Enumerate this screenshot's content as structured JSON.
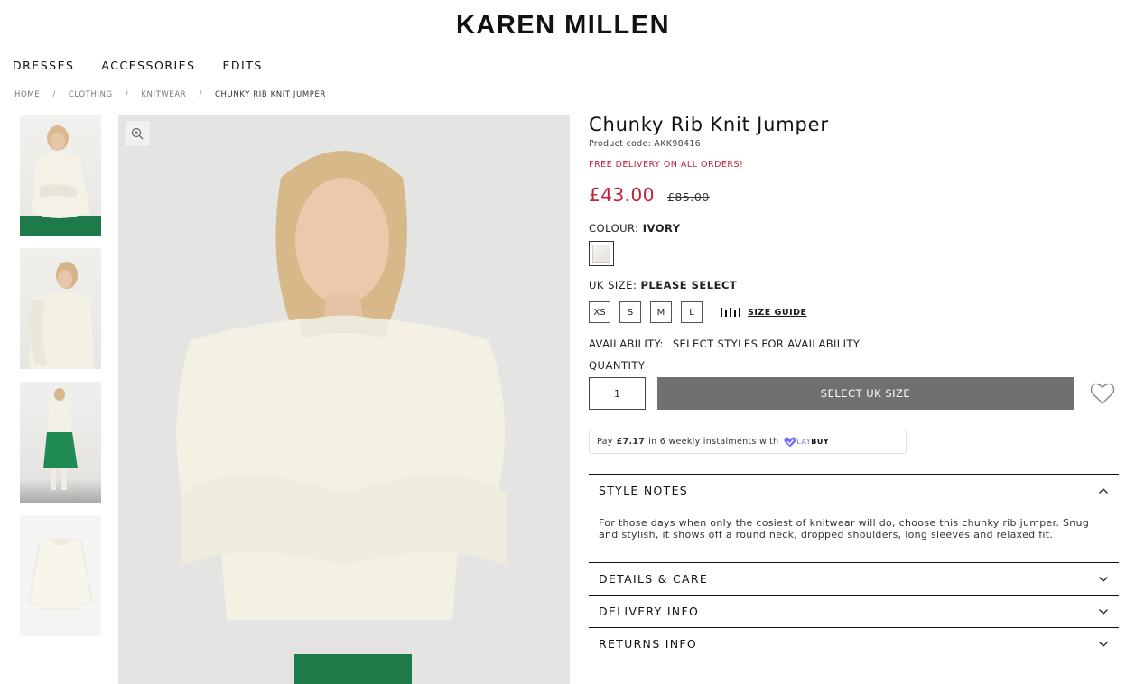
{
  "brand": {
    "logo_text": "KAREN MILLEN"
  },
  "nav": {
    "items": [
      "DRESSES",
      "ACCESSORIES",
      "EDITS"
    ]
  },
  "breadcrumb": {
    "items": [
      "HOME",
      "CLOTHING",
      "KNITWEAR",
      "CHUNKY RIB KNIT JUMPER"
    ],
    "separator": "/"
  },
  "product": {
    "title": "Chunky Rib Knit Jumper",
    "code": "Product code: AKK98416",
    "free_delivery": "FREE DELIVERY ON ALL ORDERS!",
    "price": "£43.00",
    "was_price": "£85.00",
    "colour_label": "COLOUR:",
    "colour_value": "IVORY",
    "size_label": "UK SIZE:",
    "size_value": "PLEASE SELECT",
    "sizes": [
      "XS",
      "S",
      "M",
      "L"
    ],
    "size_guide": "SIZE GUIDE",
    "availability_label": "AVAILABILITY:",
    "availability_value": "SELECT STYLES FOR AVAILABILITY",
    "quantity_label": "QUANTITY",
    "quantity_value": "1",
    "add_button": "SELECT UK SIZE"
  },
  "laybuy": {
    "prefix": "Pay",
    "amount": "£7.17",
    "suffix": "in 6 weekly instalments with",
    "brand_a": "LAY",
    "brand_b": "BUY"
  },
  "accordion": {
    "style_notes": {
      "title": "STYLE NOTES",
      "body": "For those days when only the cosiest of knitwear will do, choose this chunky rib jumper. Snug and stylish, it shows off a round neck, dropped shoulders, long sleeves and relaxed fit."
    },
    "details": {
      "title": "DETAILS & CARE"
    },
    "delivery": {
      "title": "DELIVERY INFO"
    },
    "returns": {
      "title": "RETURNS INFO"
    }
  },
  "colors": {
    "price_red": "#c0213c",
    "button_grey": "#707070",
    "laybuy_purple": "#786dff"
  }
}
